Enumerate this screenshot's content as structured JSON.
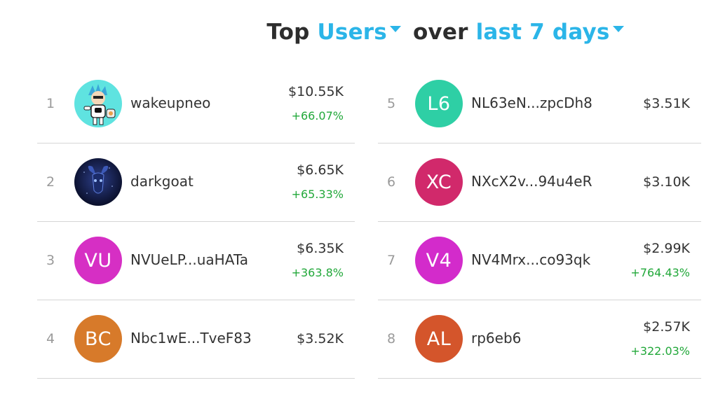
{
  "header": {
    "prefix": "Top",
    "metric": "Users",
    "middle": "over",
    "period": "last 7 days"
  },
  "colors": {
    "accent": "#2bb5e8",
    "positive": "#22a83a"
  },
  "users": [
    {
      "rank": "1",
      "name": "wakeupneo",
      "value": "$10.55K",
      "change": "+66.07%",
      "avatar": {
        "type": "image",
        "icon": "robot-avatar-icon"
      }
    },
    {
      "rank": "2",
      "name": "darkgoat",
      "value": "$6.65K",
      "change": "+65.33%",
      "avatar": {
        "type": "image",
        "icon": "goat-avatar-icon"
      }
    },
    {
      "rank": "3",
      "name": "NVUeLP...uaHATa",
      "value": "$6.35K",
      "change": "+363.8%",
      "avatar": {
        "type": "initials",
        "initials": "VU",
        "color": "#d62fc4"
      }
    },
    {
      "rank": "4",
      "name": "Nbc1wE...TveF83",
      "value": "$3.52K",
      "change": "",
      "avatar": {
        "type": "initials",
        "initials": "BC",
        "color": "#d77a2a"
      }
    },
    {
      "rank": "5",
      "name": "NL63eN...zpcDh8",
      "value": "$3.51K",
      "change": "",
      "avatar": {
        "type": "initials",
        "initials": "L6",
        "color": "#2ecfa5"
      }
    },
    {
      "rank": "6",
      "name": "NXcX2v...94u4eR",
      "value": "$3.10K",
      "change": "",
      "avatar": {
        "type": "initials",
        "initials": "XC",
        "color": "#d1296b"
      }
    },
    {
      "rank": "7",
      "name": "NV4Mrx...co93qk",
      "value": "$2.99K",
      "change": "+764.43%",
      "avatar": {
        "type": "initials",
        "initials": "V4",
        "color": "#d32bcb"
      }
    },
    {
      "rank": "8",
      "name": "rp6eb6",
      "value": "$2.57K",
      "change": "+322.03%",
      "avatar": {
        "type": "initials",
        "initials": "AL",
        "color": "#d4552b"
      }
    }
  ]
}
